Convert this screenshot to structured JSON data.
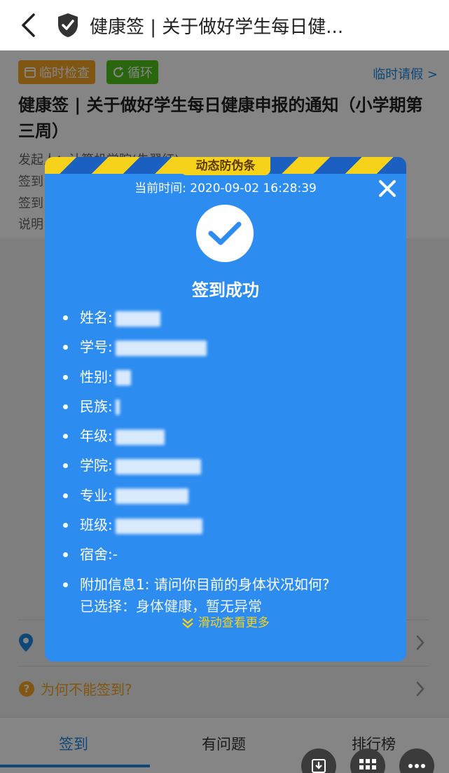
{
  "header": {
    "title": "健康签 | 关于做好学生每日健..."
  },
  "page": {
    "tags": [
      {
        "label": "临时检查",
        "color": "#f5a623"
      },
      {
        "label": "循环",
        "color": "#52c41a"
      }
    ],
    "leave_link": "临时请假 >",
    "notice_title": "健康签 | 关于做好学生每日健康申报的通知（小学期第三周）",
    "meta": [
      "发起人：计算机学院(朱翠红)",
      "签到",
      "签到",
      "说明"
    ],
    "rows": [
      {
        "text": "为何不能签到?"
      }
    ],
    "tabs": [
      {
        "label": "签到",
        "active": true
      },
      {
        "label": "有问题",
        "active": false
      },
      {
        "label": "排行榜",
        "active": false
      }
    ]
  },
  "modal": {
    "stripe_label": "动态防伪条",
    "current_time": "当前时间: 2020-09-02 16:28:39",
    "status": "签到成功",
    "fields": [
      {
        "label": "姓名:",
        "value": ""
      },
      {
        "label": "学号:",
        "value": ""
      },
      {
        "label": "性别:",
        "value": ""
      },
      {
        "label": "民族:",
        "value": ""
      },
      {
        "label": "年级:",
        "value": ""
      },
      {
        "label": "学院:",
        "value": ""
      },
      {
        "label": "专业:",
        "value": ""
      },
      {
        "label": "班级:",
        "value": ""
      },
      {
        "label": "宿舍:",
        "value": "-"
      }
    ],
    "extra": {
      "label": "附加信息1: 请问你目前的身体状况如何?",
      "answer": "已选择：身体健康，暂无异常"
    },
    "scroll_hint": "滑动查看更多"
  },
  "colors": {
    "accent_blue": "#2d8cf0",
    "hazard_yellow": "#f7d21a",
    "tab_active": "#1e88e5"
  },
  "icons": [
    "back-arrow-icon",
    "shield-check-icon",
    "calendar-icon",
    "refresh-icon",
    "close-icon",
    "checkmark-icon",
    "location-pin-icon",
    "question-icon",
    "chevron-right-icon",
    "download-icon",
    "grid-icon",
    "more-icon",
    "double-chevron-down-icon"
  ]
}
